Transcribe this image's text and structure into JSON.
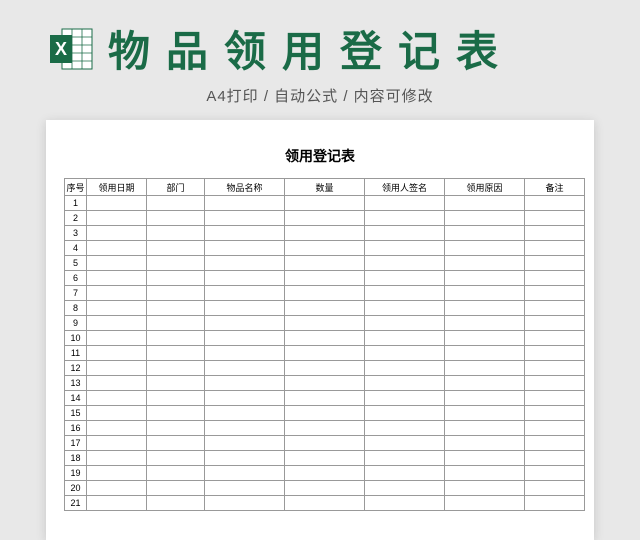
{
  "header": {
    "title": "物品领用登记表",
    "subtitle": "A4打印 / 自动公式 / 内容可修改"
  },
  "sheet": {
    "title": "领用登记表",
    "columns": [
      "序号",
      "领用日期",
      "部门",
      "物品名称",
      "数量",
      "领用人签名",
      "领用原因",
      "备注"
    ],
    "rows": [
      "1",
      "2",
      "3",
      "4",
      "5",
      "6",
      "7",
      "8",
      "9",
      "10",
      "11",
      "12",
      "13",
      "14",
      "15",
      "16",
      "17",
      "18",
      "19",
      "20",
      "21"
    ]
  },
  "colors": {
    "brand_green": "#1a6b47",
    "page_bg": "#e8e8e8"
  },
  "icons": {
    "excel": "excel-icon"
  }
}
